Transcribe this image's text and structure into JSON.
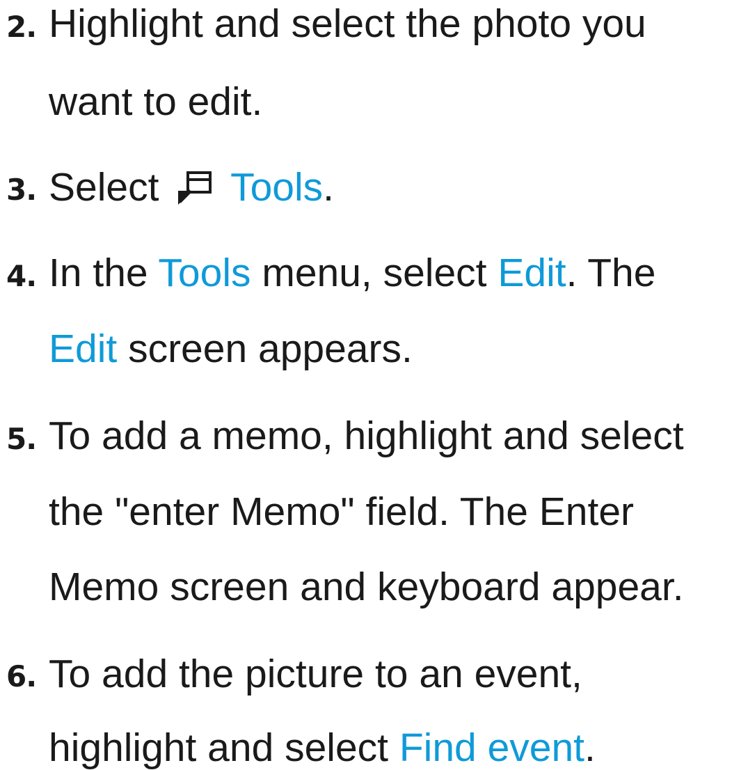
{
  "steps": [
    {
      "number": "2.",
      "lines": [
        {
          "text": "Highlight and select the photo you"
        },
        {
          "text": "want to edit."
        }
      ]
    },
    {
      "number": "3.",
      "prefix": "Select",
      "icon": "tools-icon",
      "link": "Tools",
      "suffix": "."
    },
    {
      "number": "4.",
      "line1": {
        "a": "In the ",
        "tools": "Tools",
        "b": " menu, select ",
        "edit": "Edit",
        "c": ". The"
      },
      "line2": {
        "edit": "Edit",
        "b": " screen appears."
      }
    },
    {
      "number": "5.",
      "lines": [
        {
          "text": "To add a memo, highlight and select"
        },
        {
          "text": "the \"enter Memo\" field. The Enter"
        },
        {
          "text": "Memo screen and keyboard appear."
        }
      ]
    },
    {
      "number": "6.",
      "line1": "To add the picture to an event,",
      "line2": {
        "a": "highlight and select ",
        "link": "Find event",
        "b": "."
      }
    }
  ],
  "colors": {
    "text": "#1a1a1a",
    "highlight": "#0f9ad8"
  }
}
